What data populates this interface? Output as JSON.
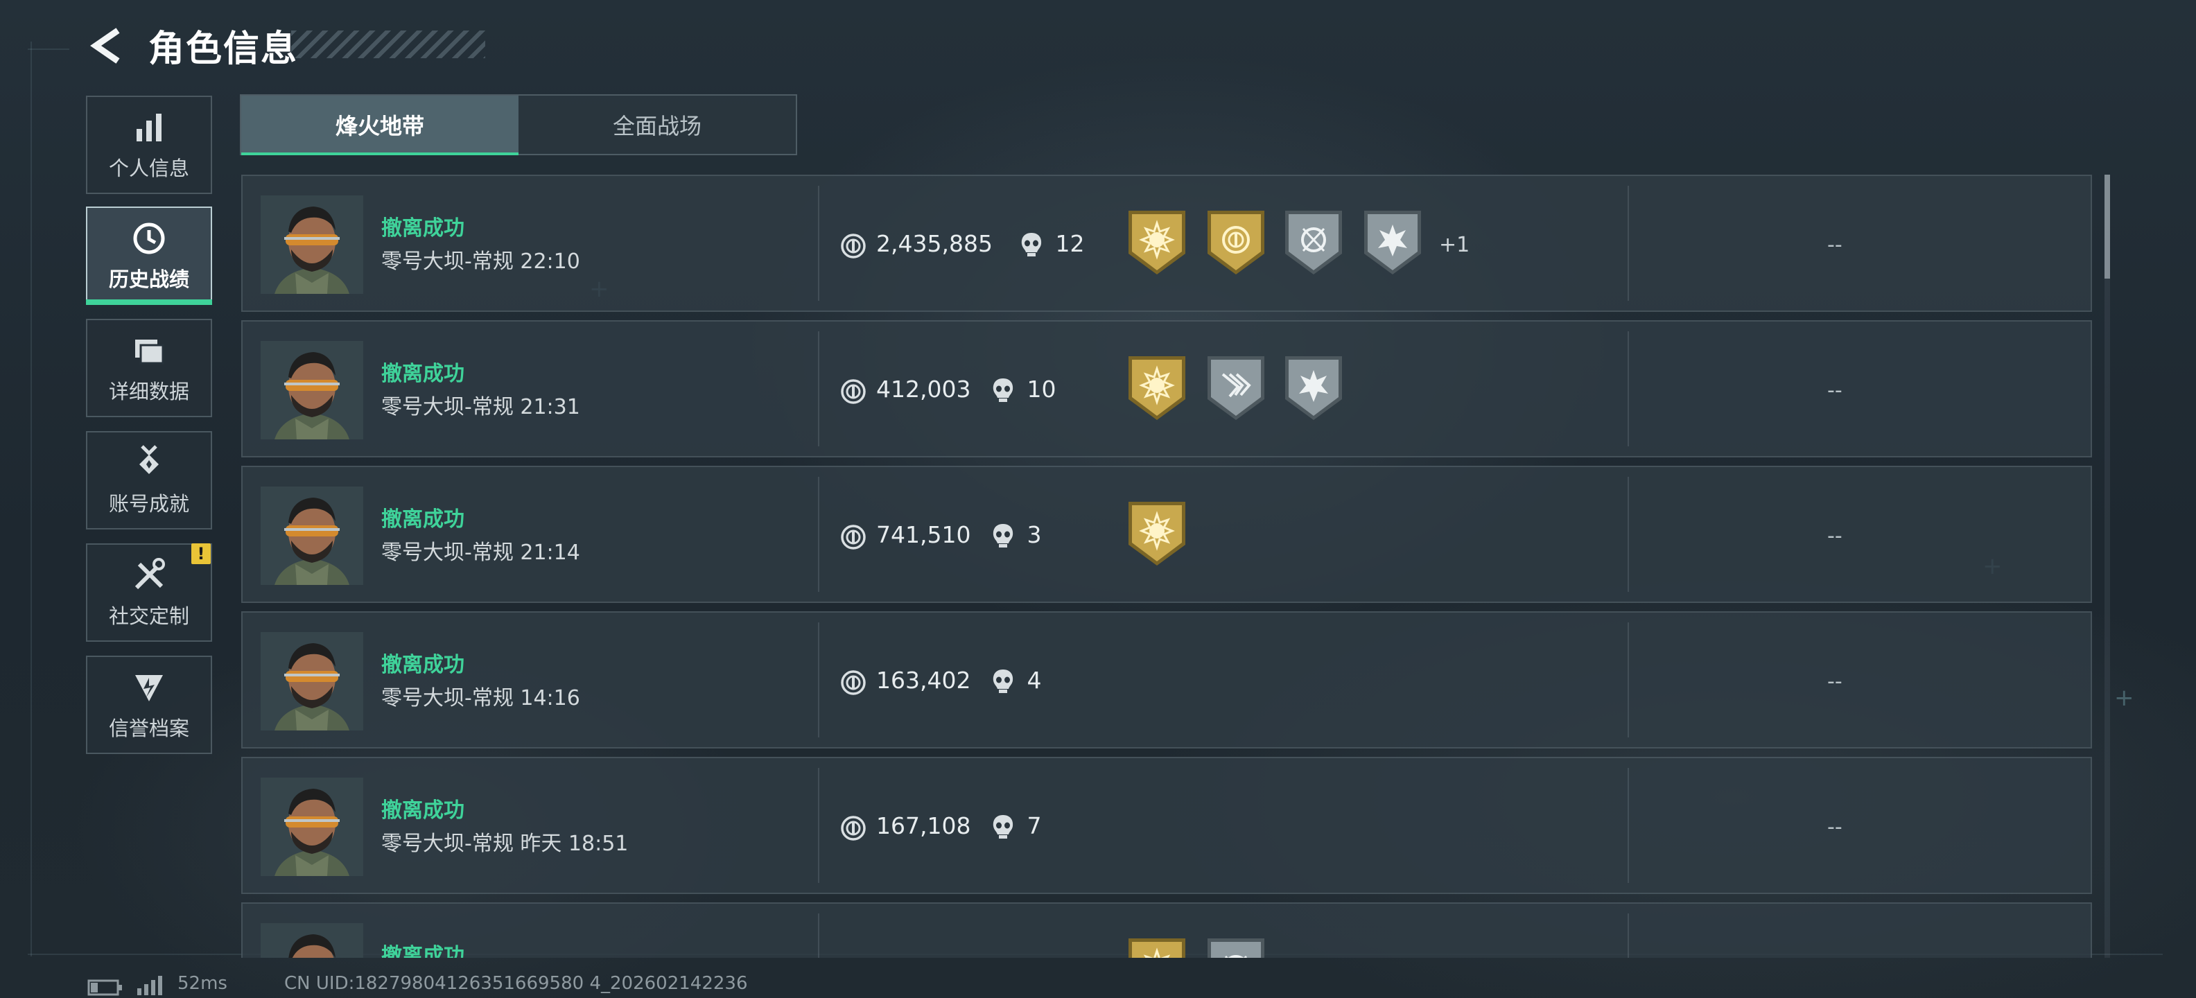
{
  "header": {
    "title": "角色信息"
  },
  "sidebar": {
    "items": [
      {
        "label": "个人信息",
        "icon": "bar-chart-icon"
      },
      {
        "label": "历史战绩",
        "icon": "clock-icon"
      },
      {
        "label": "详细数据",
        "icon": "folder-icon"
      },
      {
        "label": "账号成就",
        "icon": "medal-icon"
      },
      {
        "label": "社交定制",
        "icon": "tools-icon"
      },
      {
        "label": "信誉档案",
        "icon": "shield-icon"
      }
    ],
    "active_index": 1,
    "alert_badge": "!"
  },
  "tabs": [
    {
      "label": "烽火地带"
    },
    {
      "label": "全面战场"
    }
  ],
  "colors": {
    "accent": "#3fd39a",
    "gold": "#c9a94e",
    "silver": "#8e9aa0"
  },
  "matches": [
    {
      "status": "撤离成功",
      "map": "零号大坝-常规",
      "time": "22:10",
      "value": "2,435,885",
      "kills": "12",
      "badges": [
        "gold-sun",
        "gold-coin",
        "silver-crosshair",
        "silver-burst"
      ],
      "more": "+1",
      "extra": "--"
    },
    {
      "status": "撤离成功",
      "map": "零号大坝-常规",
      "time": "21:31",
      "value": "412,003",
      "kills": "10",
      "badges": [
        "gold-sun",
        "silver-wings",
        "silver-burst"
      ],
      "more": "",
      "extra": "--"
    },
    {
      "status": "撤离成功",
      "map": "零号大坝-常规",
      "time": "21:14",
      "value": "741,510",
      "kills": "3",
      "badges": [
        "gold-sun"
      ],
      "more": "",
      "extra": "--"
    },
    {
      "status": "撤离成功",
      "map": "零号大坝-常规",
      "time": "14:16",
      "value": "163,402",
      "kills": "4",
      "badges": [],
      "more": "",
      "extra": "--"
    },
    {
      "status": "撤离成功",
      "map": "零号大坝-常规",
      "time": "昨天 18:51",
      "value": "167,108",
      "kills": "7",
      "badges": [],
      "more": "",
      "extra": "--"
    },
    {
      "status": "撤离成功",
      "map": "",
      "time": "",
      "value": "",
      "kills": "",
      "badges": [
        "gold-sun",
        "silver-crosshair"
      ],
      "more": "",
      "extra": ""
    }
  ],
  "footer": {
    "ping": "52ms",
    "uid": "CN UID:18279804126351669580 4_202602142236"
  }
}
